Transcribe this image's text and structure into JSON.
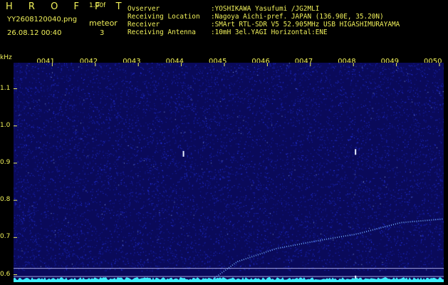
{
  "header": {
    "logo": "H R O F F T",
    "version": "1.00f",
    "filename": "YY2608120040.png",
    "datetime": "26.08.12 00:40",
    "meteor_label": "meteor",
    "meteor_count": "3",
    "info": [
      {
        "key": "Ovserver",
        "value": ":YOSHIKAWA Yasufumi /JG2MLI"
      },
      {
        "key": "Receiving Location",
        "value": ":Nagoya Aichi-pref. JAPAN (136.90E, 35.20N)"
      },
      {
        "key": "Receiver",
        "value": ":SMArt RTL-SDR V5 52.905MHz USB HIGASHIMURAYAMA"
      },
      {
        "key": "Receiving Antenna",
        "value": ":10mH 3el.YAGI Horizontal:ENE"
      }
    ]
  },
  "chart_data": {
    "type": "heatmap",
    "ylabel": "kHz",
    "yticks": [
      "1.1",
      "1.0",
      "0.9",
      "0.8",
      "0.7",
      "0.6"
    ],
    "ylim": [
      0.58,
      1.17
    ],
    "xticks": [
      "0041",
      "0042",
      "0043",
      "0044",
      "0045",
      "0046",
      "0047",
      "0048",
      "0049",
      "0050"
    ],
    "xlim": [
      0,
      10
    ],
    "colors": {
      "background": "#0a0a5a",
      "noise": "#2a3cff",
      "signal": "#6fa8ff",
      "spectrum": "#3ff0ff",
      "axis_text": "#f0f05a",
      "tick": "#f0f05a"
    },
    "reference_lines_khz": [
      0.617,
      0.595
    ],
    "meteors": [
      {
        "minute": 3.95,
        "freq_khz": 0.925
      },
      {
        "minute": 7.95,
        "freq_khz": 0.93
      },
      {
        "minute": 7.95,
        "freq_khz": 0.59
      }
    ],
    "drift_trace": [
      {
        "minute": 4.6,
        "freq_khz": 0.585
      },
      {
        "minute": 5.2,
        "freq_khz": 0.635
      },
      {
        "minute": 6.1,
        "freq_khz": 0.67
      },
      {
        "minute": 7.0,
        "freq_khz": 0.69
      },
      {
        "minute": 8.0,
        "freq_khz": 0.71
      },
      {
        "minute": 9.0,
        "freq_khz": 0.74
      },
      {
        "minute": 10.0,
        "freq_khz": 0.75
      }
    ]
  }
}
